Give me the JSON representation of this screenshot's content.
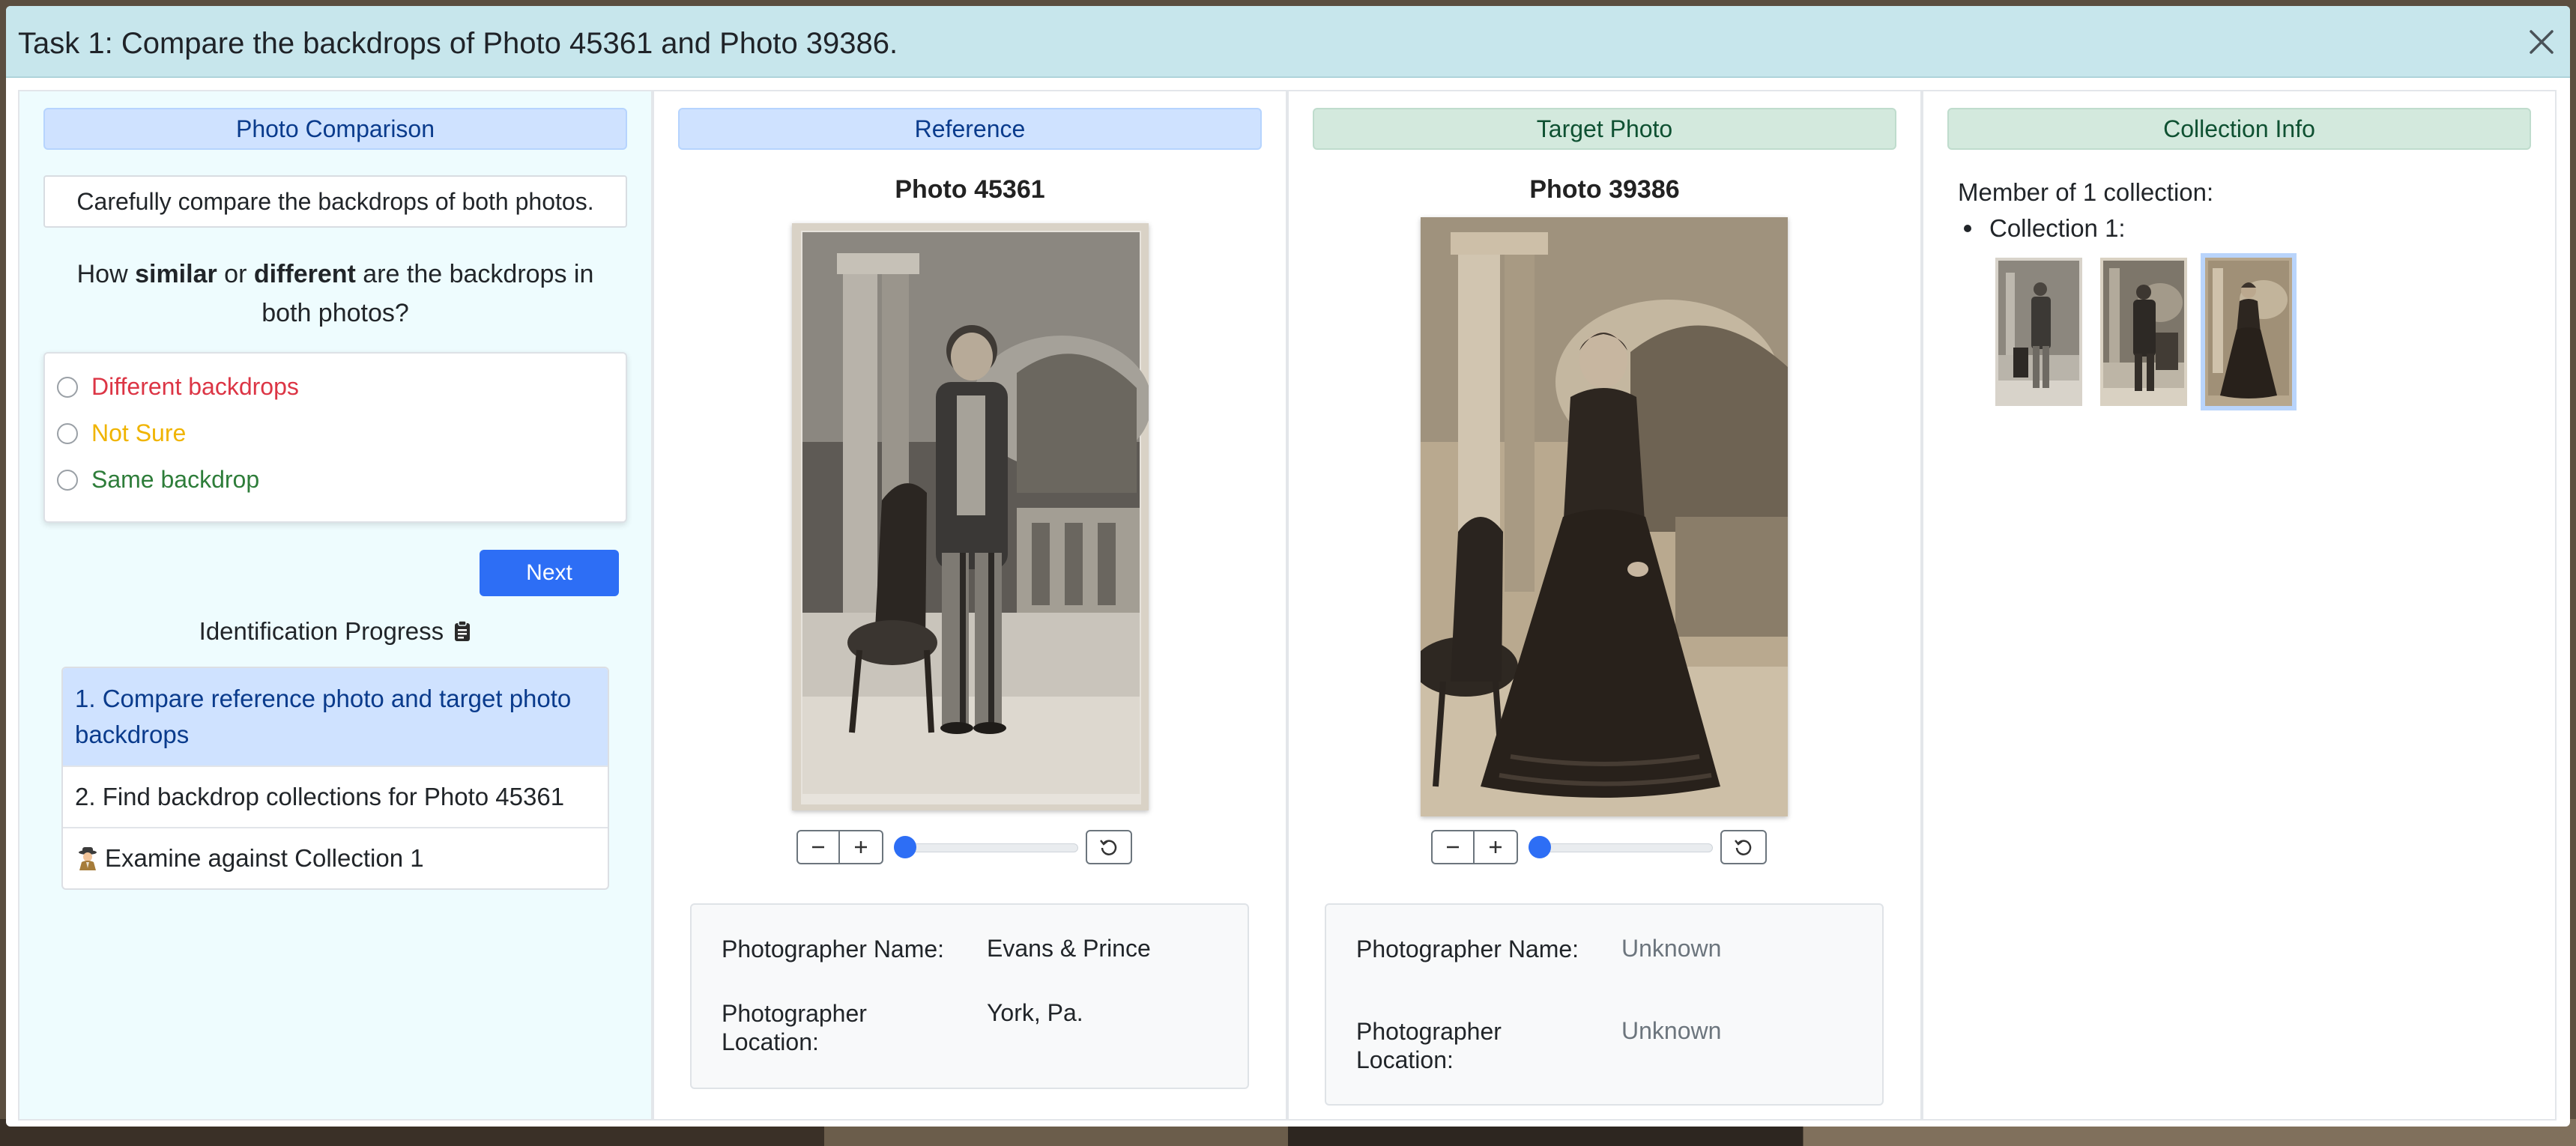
{
  "modal": {
    "title": "Task 1: Compare the backdrops of Photo 45361 and Photo 39386."
  },
  "comparison_panel": {
    "header": "Photo Comparison",
    "instruction": "Carefully compare the backdrops of both photos.",
    "question_prefix": "How ",
    "question_similar": "similar",
    "question_or": " or ",
    "question_different": "different",
    "question_suffix": " are the backdrops in both photos?",
    "options": [
      "Different backdrops",
      "Not Sure",
      "Same backdrop"
    ],
    "next_label": "Next",
    "progress_title": "Identification Progress",
    "progress_items": [
      "1. Compare reference photo and target photo backdrops",
      "2. Find backdrop collections for Photo 45361",
      "Examine against Collection 1"
    ]
  },
  "reference_panel": {
    "header": "Reference",
    "photo_title": "Photo 45361",
    "photographer_name_label": "Photographer Name:",
    "photographer_name": "Evans & Prince",
    "photographer_location_label": "Photographer Location:",
    "photographer_location": "York, Pa.",
    "zoom_level": 0
  },
  "target_panel": {
    "header": "Target Photo",
    "photo_title": "Photo 39386",
    "photographer_name_label": "Photographer Name:",
    "photographer_name": "Unknown",
    "photographer_location_label": "Photographer Location:",
    "photographer_location": "Unknown",
    "zoom_level": 0
  },
  "collection_panel": {
    "header": "Collection Info",
    "member_text": "Member of 1 collection:",
    "collections": [
      "Collection 1:"
    ],
    "thumbnail_count": 3,
    "selected_thumbnail": 3
  },
  "colors": {
    "header_bg": "#c7e6ec",
    "accent_blue": "#2d6ef5",
    "option_red": "#dc3545",
    "option_yellow": "#f0b400",
    "option_green": "#2e7d3a"
  },
  "icons": {
    "close": "close-icon",
    "clipboard": "clipboard-icon",
    "detective": "detective-icon",
    "zoom_out": "minus-icon",
    "zoom_in": "plus-icon",
    "reset": "reset-icon"
  }
}
